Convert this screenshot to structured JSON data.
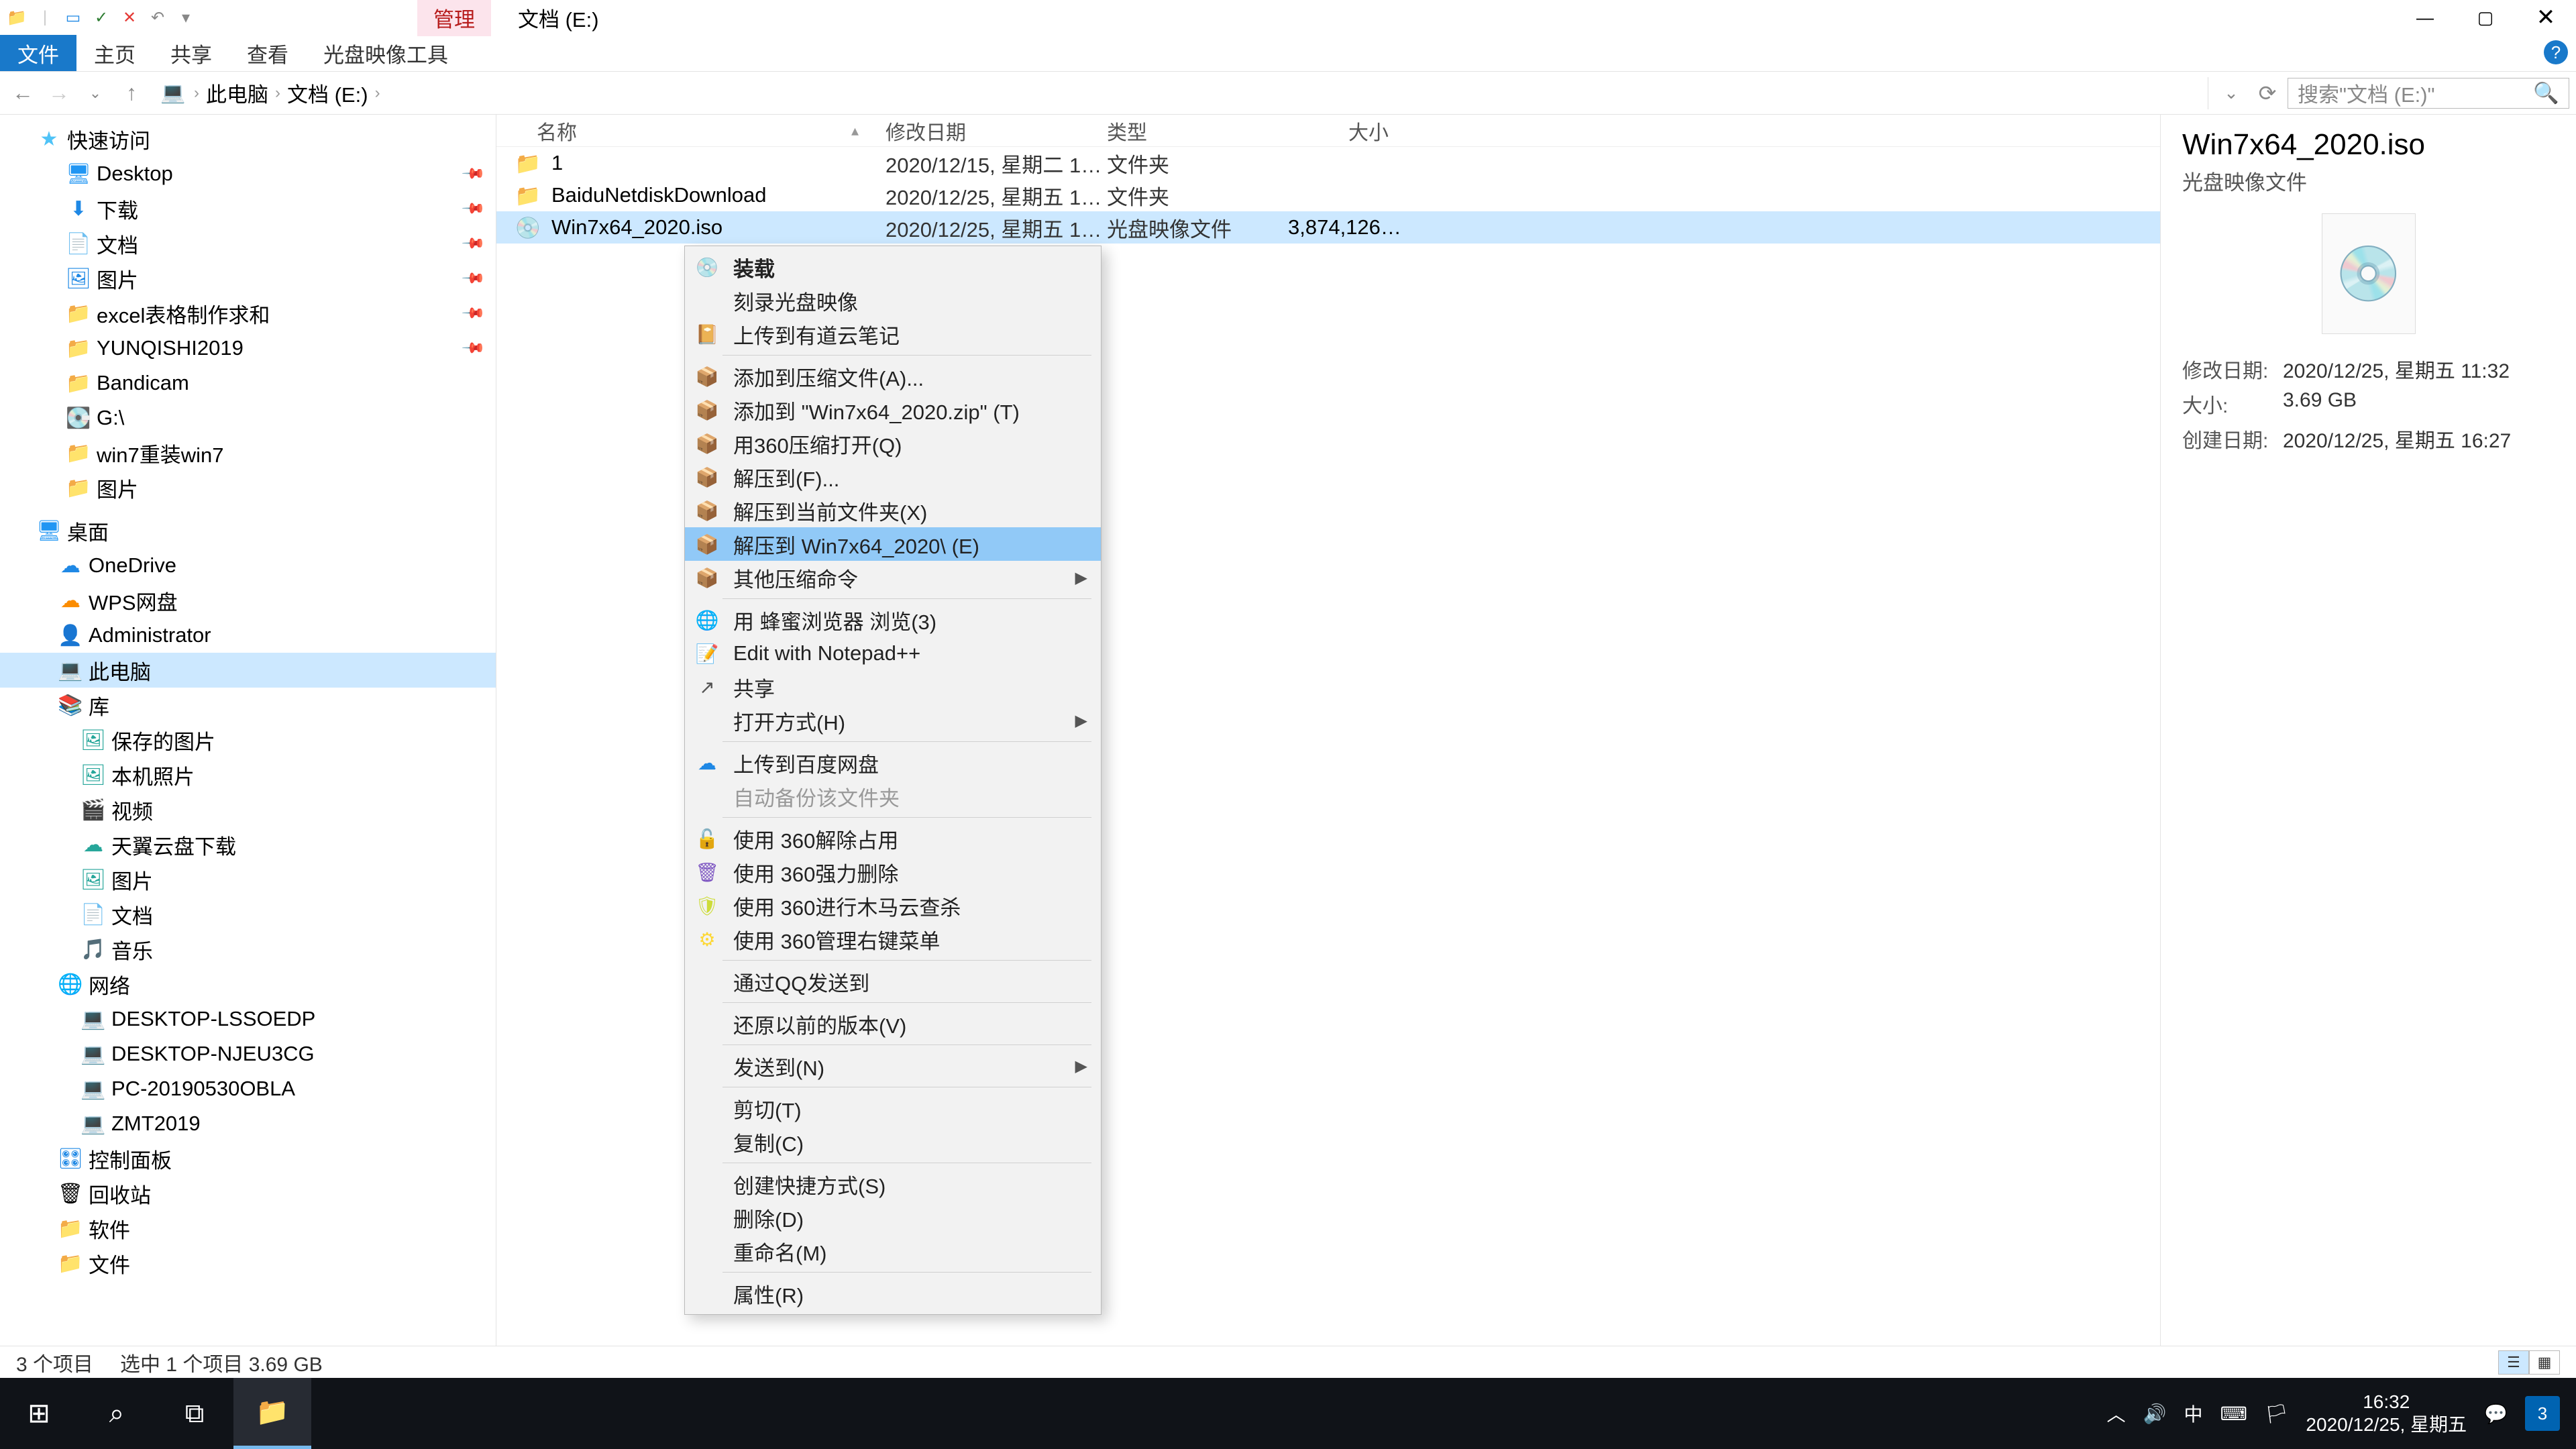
{
  "titlebar": {
    "manage": "管理",
    "title": "文档 (E:)"
  },
  "winctl": {
    "min": "—",
    "max": "▢",
    "close": "✕",
    "help": "?"
  },
  "ribbon": {
    "file": "文件",
    "home": "主页",
    "share": "共享",
    "view": "查看",
    "disc": "光盘映像工具"
  },
  "nav": {
    "back": "←",
    "fwd": "→",
    "up": "↑",
    "refresh": "⟳",
    "dd": "⌄"
  },
  "breadcrumb": {
    "pc": "此电脑",
    "drive": "文档 (E:)"
  },
  "search": {
    "placeholder": "搜索\"文档 (E:)\""
  },
  "columns": {
    "name": "名称",
    "mod": "修改日期",
    "type": "类型",
    "size": "大小"
  },
  "rows": [
    {
      "ic": "📁",
      "cls": "ic-folder",
      "name": "1",
      "mod": "2020/12/15, 星期二 1…",
      "type": "文件夹",
      "size": ""
    },
    {
      "ic": "📁",
      "cls": "ic-folder",
      "name": "BaiduNetdiskDownload",
      "mod": "2020/12/25, 星期五 1…",
      "type": "文件夹",
      "size": ""
    },
    {
      "ic": "💿",
      "cls": "",
      "name": "Win7x64_2020.iso",
      "mod": "2020/12/25, 星期五 1…",
      "type": "光盘映像文件",
      "size": "3,874,126…",
      "sel": true
    }
  ],
  "sidebar": {
    "quick": {
      "label": "快速访问",
      "items": [
        {
          "ic": "🖥",
          "cls": "ic-desk",
          "label": "Desktop",
          "pin": true
        },
        {
          "ic": "⬇",
          "cls": "ic-blue",
          "label": "下载",
          "pin": true
        },
        {
          "ic": "📄",
          "cls": "ic-blue",
          "label": "文档",
          "pin": true
        },
        {
          "ic": "🖼",
          "cls": "ic-blue",
          "label": "图片",
          "pin": true
        },
        {
          "ic": "📁",
          "cls": "ic-folder",
          "label": "excel表格制作求和",
          "pin": true
        },
        {
          "ic": "📁",
          "cls": "ic-folder",
          "label": "YUNQISHI2019",
          "pin": true
        },
        {
          "ic": "📁",
          "cls": "ic-folder",
          "label": "Bandicam"
        },
        {
          "ic": "💽",
          "cls": "",
          "label": "G:\\"
        },
        {
          "ic": "📁",
          "cls": "ic-folder",
          "label": "win7重装win7"
        },
        {
          "ic": "📁",
          "cls": "ic-folder",
          "label": "图片"
        }
      ]
    },
    "desktop": {
      "label": "桌面",
      "items": [
        {
          "ic": "☁",
          "cls": "ic-blue",
          "label": "OneDrive"
        },
        {
          "ic": "☁",
          "cls": "ic-orange",
          "label": "WPS网盘"
        },
        {
          "ic": "👤",
          "cls": "",
          "label": "Administrator"
        },
        {
          "ic": "💻",
          "cls": "",
          "label": "此电脑",
          "sel": true
        },
        {
          "ic": "📚",
          "cls": "ic-teal",
          "label": "库"
        }
      ]
    },
    "lib_items": [
      {
        "ic": "🖼",
        "cls": "ic-teal",
        "label": "保存的图片"
      },
      {
        "ic": "🖼",
        "cls": "ic-teal",
        "label": "本机照片"
      },
      {
        "ic": "🎬",
        "cls": "ic-teal",
        "label": "视频"
      },
      {
        "ic": "☁",
        "cls": "ic-teal",
        "label": "天翼云盘下载"
      },
      {
        "ic": "🖼",
        "cls": "ic-teal",
        "label": "图片"
      },
      {
        "ic": "📄",
        "cls": "ic-teal",
        "label": "文档"
      },
      {
        "ic": "🎵",
        "cls": "ic-teal",
        "label": "音乐"
      }
    ],
    "network": {
      "label": "网络",
      "items": [
        {
          "ic": "💻",
          "cls": "",
          "label": "DESKTOP-LSSOEDP"
        },
        {
          "ic": "💻",
          "cls": "",
          "label": "DESKTOP-NJEU3CG"
        },
        {
          "ic": "💻",
          "cls": "",
          "label": "PC-20190530OBLA"
        },
        {
          "ic": "💻",
          "cls": "",
          "label": "ZMT2019"
        }
      ]
    },
    "extras": [
      {
        "ic": "🎛",
        "cls": "ic-blue",
        "label": "控制面板"
      },
      {
        "ic": "🗑",
        "cls": "",
        "label": "回收站"
      },
      {
        "ic": "📁",
        "cls": "ic-folder",
        "label": "软件"
      },
      {
        "ic": "📁",
        "cls": "ic-folder",
        "label": "文件"
      }
    ]
  },
  "ctx": [
    {
      "ic": "💿",
      "cls": "",
      "label": "装载",
      "bold": true
    },
    {
      "ic": "",
      "cls": "",
      "label": "刻录光盘映像"
    },
    {
      "ic": "📔",
      "cls": "ic-blue",
      "label": "上传到有道云笔记"
    },
    {
      "sep": true
    },
    {
      "ic": "📦",
      "cls": "ic-zip",
      "label": "添加到压缩文件(A)..."
    },
    {
      "ic": "📦",
      "cls": "ic-zip",
      "label": "添加到 \"Win7x64_2020.zip\" (T)"
    },
    {
      "ic": "📦",
      "cls": "ic-zip",
      "label": "用360压缩打开(Q)"
    },
    {
      "ic": "📦",
      "cls": "ic-zip",
      "label": "解压到(F)..."
    },
    {
      "ic": "📦",
      "cls": "ic-zip",
      "label": "解压到当前文件夹(X)"
    },
    {
      "ic": "📦",
      "cls": "ic-zip",
      "label": "解压到 Win7x64_2020\\ (E)",
      "hover": true
    },
    {
      "ic": "📦",
      "cls": "ic-zip",
      "label": "其他压缩命令",
      "sub": true
    },
    {
      "sep": true
    },
    {
      "ic": "🌐",
      "cls": "ic-green",
      "label": "用 蜂蜜浏览器 浏览(3)"
    },
    {
      "ic": "📝",
      "cls": "ic-npp",
      "label": "Edit with Notepad++"
    },
    {
      "ic": "↗",
      "cls": "ic-sh",
      "label": "共享"
    },
    {
      "ic": "",
      "cls": "",
      "label": "打开方式(H)",
      "sub": true
    },
    {
      "sep": true
    },
    {
      "ic": "☁",
      "cls": "ic-blue",
      "label": "上传到百度网盘"
    },
    {
      "ic": "",
      "cls": "",
      "label": "自动备份该文件夹",
      "disabled": true
    },
    {
      "sep": true
    },
    {
      "ic": "🔓",
      "cls": "ic-orange",
      "label": "使用 360解除占用"
    },
    {
      "ic": "🗑",
      "cls": "ic-purple",
      "label": "使用 360强力删除"
    },
    {
      "ic": "🛡",
      "cls": "ic-lime",
      "label": "使用 360进行木马云查杀"
    },
    {
      "ic": "⚙",
      "cls": "ic-yellow",
      "label": "使用 360管理右键菜单"
    },
    {
      "sep": true
    },
    {
      "ic": "",
      "cls": "",
      "label": "通过QQ发送到"
    },
    {
      "sep": true
    },
    {
      "ic": "",
      "cls": "",
      "label": "还原以前的版本(V)"
    },
    {
      "sep": true
    },
    {
      "ic": "",
      "cls": "",
      "label": "发送到(N)",
      "sub": true
    },
    {
      "sep": true
    },
    {
      "ic": "",
      "cls": "",
      "label": "剪切(T)"
    },
    {
      "ic": "",
      "cls": "",
      "label": "复制(C)"
    },
    {
      "sep": true
    },
    {
      "ic": "",
      "cls": "",
      "label": "创建快捷方式(S)"
    },
    {
      "ic": "",
      "cls": "",
      "label": "删除(D)"
    },
    {
      "ic": "",
      "cls": "",
      "label": "重命名(M)"
    },
    {
      "sep": true
    },
    {
      "ic": "",
      "cls": "",
      "label": "属性(R)"
    }
  ],
  "details": {
    "title": "Win7x64_2020.iso",
    "type": "光盘映像文件",
    "rows": [
      {
        "k": "修改日期:",
        "v": "2020/12/25, 星期五 11:32"
      },
      {
        "k": "大小:",
        "v": "3.69 GB"
      },
      {
        "k": "创建日期:",
        "v": "2020/12/25, 星期五 16:27"
      }
    ]
  },
  "status": {
    "count": "3 个项目",
    "sel": "选中 1 个项目  3.69 GB"
  },
  "taskbar": {
    "time": "16:32",
    "date": "2020/12/25, 星期五",
    "ime": "中",
    "badge": "3"
  },
  "qat": {
    "save": "✓",
    "close": "✕"
  }
}
